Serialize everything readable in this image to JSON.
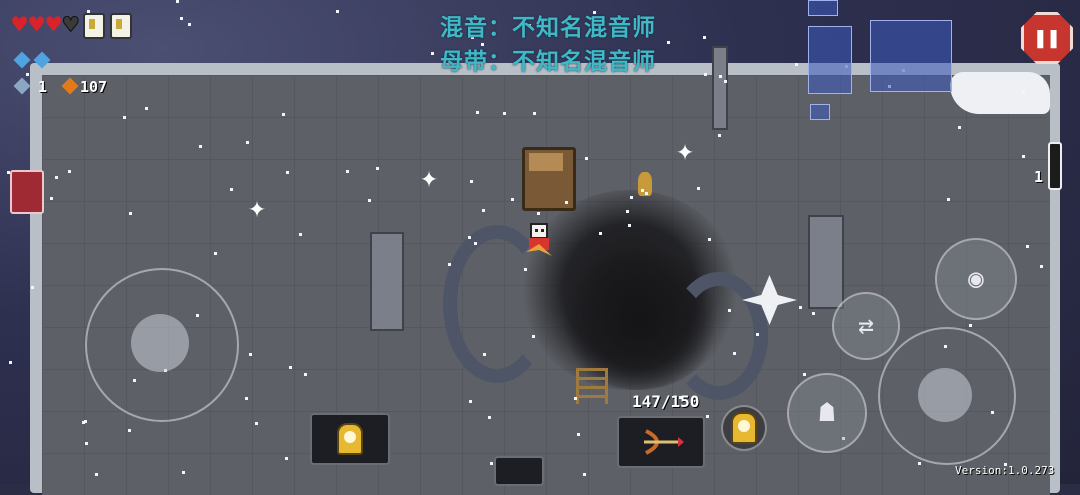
{
  "hud": {
    "hearts": [
      {
        "icon": "heart-full",
        "color": "#d8232a"
      },
      {
        "icon": "heart-full",
        "color": "#d8232a"
      },
      {
        "icon": "heart-full",
        "color": "#d8232a"
      },
      {
        "icon": "heart-empty",
        "color": "#3a3a3a"
      }
    ],
    "shields_icon": "armor-shield-icon",
    "mana_icon": "mana-crystal-icon",
    "key_count": "1",
    "gem_count": "107"
  },
  "subtitles": {
    "line1": "混音：不知名混音师",
    "line2": "母带：不知名混音师"
  },
  "weapon": {
    "ammo": "147/150",
    "icon": "crossbow-weapon-icon"
  },
  "potion_count": "1",
  "version": "Version:1.0.273",
  "colors": {
    "subtitle": "#3fb9c7",
    "pause": "#c7352f",
    "floor": "#5d6066"
  }
}
